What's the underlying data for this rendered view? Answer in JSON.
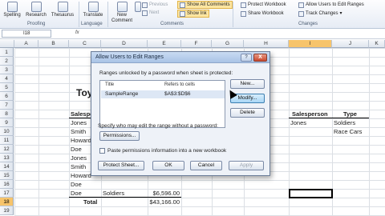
{
  "ribbon": {
    "proofing": {
      "spelling": "Spelling",
      "research": "Research",
      "thesaurus": "Thesaurus",
      "label": "Proofing"
    },
    "language": {
      "translate": "Translate",
      "label": "Language"
    },
    "comments": {
      "new_comment": "New Comment",
      "delete": "Delete",
      "previous": "Previous",
      "next": "Next",
      "show_all": "Show All Comments",
      "show_ink": "Show Ink",
      "label": "Comments"
    },
    "changes": {
      "protect_workbook": "Protect Workbook",
      "share_workbook": "Share Workbook",
      "allow_users": "Allow Users to Edit Ranges",
      "track_changes": "Track Changes",
      "label": "Changes"
    }
  },
  "formula_bar": {
    "name_box": "I18",
    "fx": "fx"
  },
  "columns": [
    "A",
    "B",
    "C",
    "D",
    "E",
    "F",
    "G",
    "H",
    "I",
    "J",
    "K"
  ],
  "rows": [
    "1",
    "2",
    "3",
    "4",
    "5",
    "6",
    "7",
    "8",
    "9",
    "10",
    "11",
    "12",
    "13",
    "14",
    "15",
    "16",
    "17",
    "18",
    "19",
    "20"
  ],
  "sheet": {
    "title_fragment": "Toy",
    "left_header": "Salesper",
    "left_names": [
      "Jones",
      "Smith",
      "Howard",
      "Doe",
      "Jones",
      "Smith",
      "Howard",
      "Doe",
      "Doe"
    ],
    "row17_product": "Soldiers",
    "row17_amount": "$6,596.00",
    "total_label": "Total",
    "total_amount": "$43,166.00",
    "right_header_salesperson": "Salesperson",
    "right_header_type": "Type",
    "right_row9_salesperson": "Jones",
    "right_row9_type": "Soldiers",
    "right_row10_type": "Race Cars"
  },
  "dialog": {
    "title": "Allow Users to Edit Ranges",
    "help": "?",
    "close": "X",
    "unlocked_label": "Ranges unlocked by a password when sheet is protected:",
    "col_title": "Title",
    "col_refers": "Refers to cells",
    "range_title": "SampleRange",
    "range_ref": "$A$3:$D$6",
    "new_btn": "New...",
    "modify_btn": "Modify...",
    "delete_btn": "Delete",
    "specify_label": "Specify who may edit the range without a password:",
    "permissions_btn": "Permissions...",
    "paste_label": "Paste permissions information into a new workbook",
    "protect_sheet_btn": "Protect Sheet...",
    "ok_btn": "OK",
    "cancel_btn": "Cancel",
    "apply_btn": "Apply"
  }
}
